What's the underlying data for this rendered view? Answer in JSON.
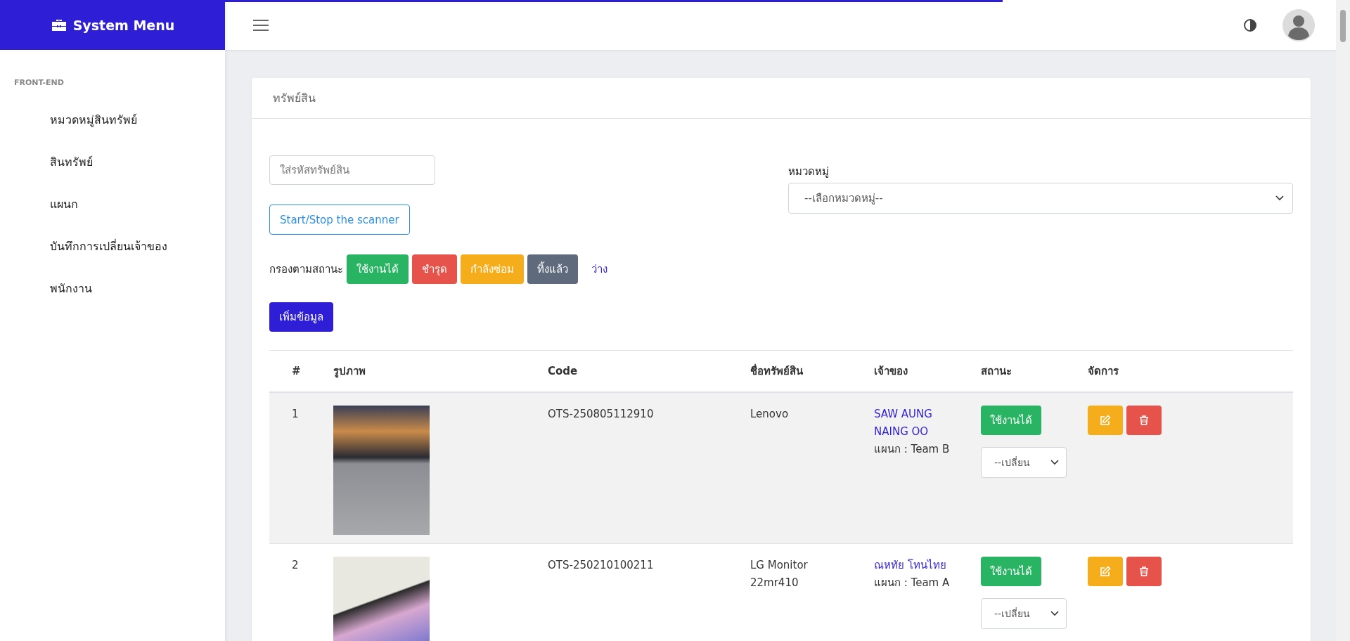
{
  "sidebar": {
    "title": "System Menu",
    "section": "FRONT-END",
    "items": [
      {
        "label": "หมวดหมู่สินทรัพย์",
        "selected": false
      },
      {
        "label": "สินทรัพย์",
        "selected": false
      },
      {
        "label": "แผนก",
        "selected": false
      },
      {
        "label": "บันทึกการเปลี่ยนเจ้าของ",
        "selected": false
      },
      {
        "label": "พนักงาน",
        "selected": false
      }
    ]
  },
  "loading_bar": {
    "level": 0.7
  },
  "card": {
    "title": "ทรัพย์สิน",
    "search": {
      "placeholder": "ใส่รหัสทรัพย์สิน"
    },
    "scanner_button": "Start/Stop the scanner",
    "category": {
      "label": "หมวดหมู่",
      "value": "--เลือกหมวดหมู่--"
    },
    "filter": {
      "label": "กรองตามสถานะ",
      "options": [
        {
          "label": "ใช้งานได้",
          "kind": "button",
          "color": "#28b463"
        },
        {
          "label": "ชำรุด",
          "kind": "button",
          "color": "#e5534b"
        },
        {
          "label": "กำลังซ่อม",
          "kind": "button",
          "color": "#f6ad1b"
        },
        {
          "label": "ทิ้งแล้ว",
          "kind": "button",
          "color": "#5f6b7d"
        },
        {
          "label": "ว่าง",
          "kind": "link",
          "color": "#2e1fd6"
        }
      ]
    },
    "add_button": "เพิ่มข้อมูล",
    "table": {
      "columns": [
        "#",
        "รูปภาพ",
        "Code",
        "ชื่อทรัพย์สิน",
        "เจ้าของ",
        "สถานะ",
        "จัดการ"
      ],
      "rows": [
        {
          "index": "1",
          "code": "OTS-250805112910",
          "name": "Lenovo",
          "owner": "SAW AUNG NAING OO",
          "department": "แผนก : Team B",
          "status": "ใช้งานได้",
          "change": "--เปลี่ยน",
          "selected": true
        },
        {
          "index": "2",
          "code": "OTS-250210100211",
          "name": "LG Monitor 22mr410",
          "owner": "ณหทัย โทนไทย",
          "department": "แผนก : Team A",
          "status": "ใช้งานได้",
          "change": "--เปลี่ยน",
          "selected": false
        }
      ]
    }
  }
}
